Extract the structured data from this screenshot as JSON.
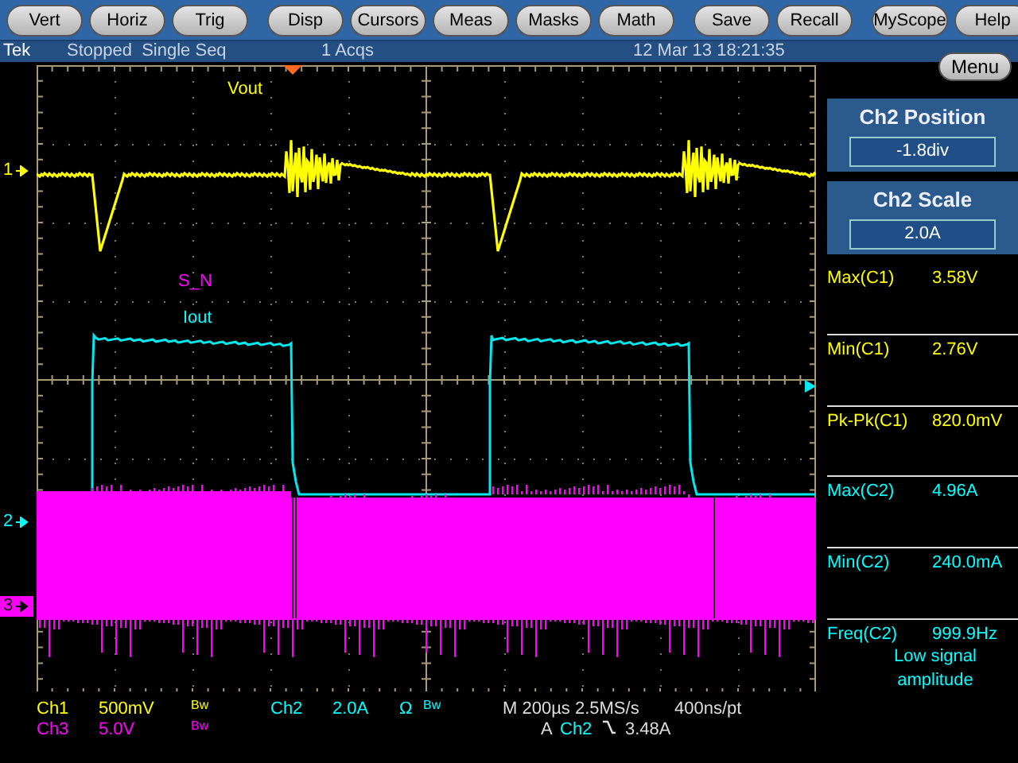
{
  "toolbar": {
    "groups": [
      [
        "Vert",
        "Horiz",
        "Trig"
      ],
      [
        "Disp",
        "Cursors",
        "Meas",
        "Masks",
        "Math"
      ],
      [
        "Save",
        "Recall"
      ],
      [
        "MyScope",
        "Help"
      ]
    ]
  },
  "status_bar": {
    "brand": "Tek",
    "state": "Stopped  Single Seq",
    "acquisitions": "1 Acqs",
    "datetime": "12 Mar 13 18:21:35"
  },
  "menu_button": "Menu",
  "controls": [
    {
      "title": "Ch2 Position",
      "value": "-1.8div"
    },
    {
      "title": "Ch2 Scale",
      "value": "2.0A"
    }
  ],
  "measurements": [
    {
      "label": "Max(C1)",
      "value": "3.58V",
      "color": "#ffff00"
    },
    {
      "label": "Min(C1)",
      "value": "2.76V",
      "color": "#ffff00"
    },
    {
      "label": "Pk-Pk(C1)",
      "value": "820.0mV",
      "color": "#ffff00"
    },
    {
      "label": "Max(C2)",
      "value": "4.96A",
      "color": "#00ffff"
    },
    {
      "label": "Min(C2)",
      "value": "240.0mA",
      "color": "#00ffff"
    },
    {
      "label": "Freq(C2)",
      "value": "999.9Hz",
      "color": "#00ffff",
      "note": "Low signal amplitude"
    }
  ],
  "channel_markers": [
    {
      "label": "1",
      "color": "#ffff00"
    },
    {
      "label": "2",
      "color": "#00ffff"
    },
    {
      "label": "3",
      "color": "#ff00ff"
    }
  ],
  "trace_labels": [
    {
      "text": "Vout",
      "color": "#ffff00"
    },
    {
      "text": "S_N",
      "color": "#ff00ff"
    },
    {
      "text": "Iout",
      "color": "#00ffff"
    }
  ],
  "readouts": {
    "channels": [
      {
        "name": "Ch1",
        "scale": "500mV",
        "bandwidth": "Bw",
        "color": "#ffff00"
      },
      {
        "name": "Ch2",
        "scale": "2.0A",
        "coupling": "Ω",
        "bandwidth": "Bw",
        "color": "#00ffff"
      },
      {
        "name": "Ch3",
        "scale": "5.0V",
        "bandwidth": "Bw",
        "color": "#ff00ff"
      }
    ],
    "horizontal": "M 200µs 2.5MS/s",
    "resolution": "400ns/pt",
    "trigger": {
      "prefix": "A",
      "source": "Ch2",
      "level": "3.48A"
    }
  }
}
